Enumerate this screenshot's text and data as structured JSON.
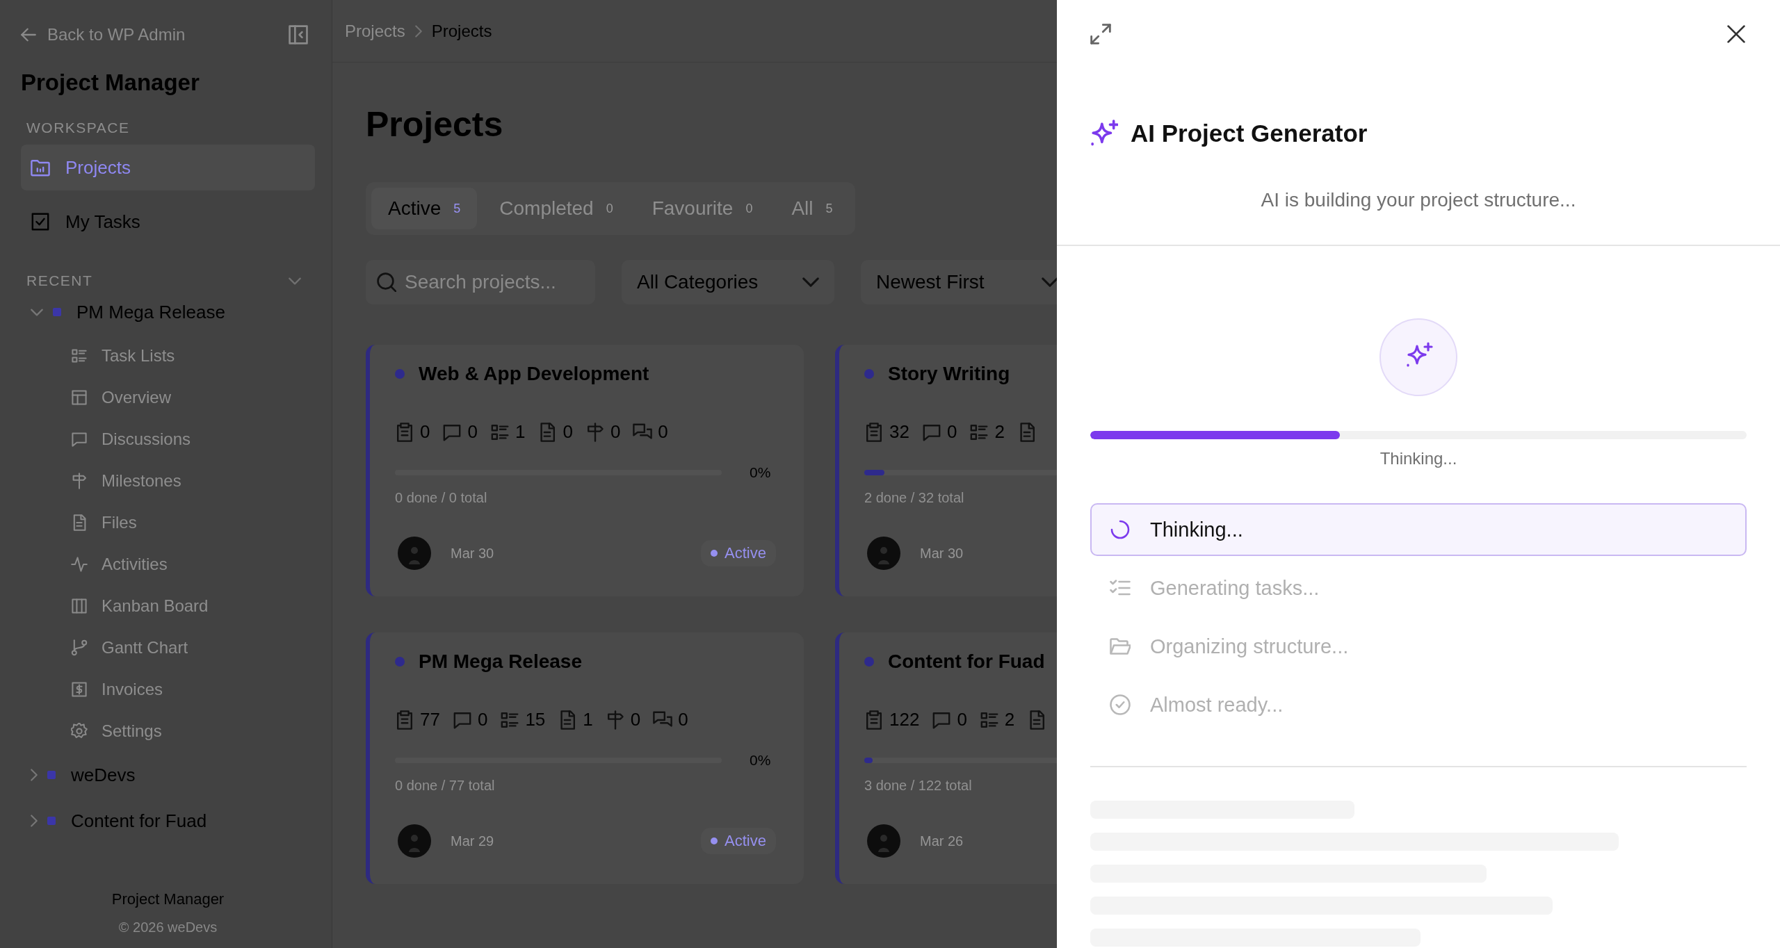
{
  "sidebar": {
    "back_link": "Back to WP Admin",
    "app_title": "Project Manager",
    "workspace_label": "WORKSPACE",
    "workspace_items": [
      {
        "label": "Projects",
        "kind": "folder",
        "selected": true
      },
      {
        "label": "My Tasks",
        "kind": "checkbox",
        "selected": false
      }
    ],
    "recent_label": "RECENT",
    "recent_projects": [
      {
        "name": "PM Mega Release",
        "expanded": true,
        "children": [
          {
            "label": "Task Lists",
            "kind": "list"
          },
          {
            "label": "Overview",
            "kind": "overview"
          },
          {
            "label": "Discussions",
            "kind": "comment"
          },
          {
            "label": "Milestones",
            "kind": "signpost"
          },
          {
            "label": "Files",
            "kind": "file"
          },
          {
            "label": "Activities",
            "kind": "activity"
          },
          {
            "label": "Kanban Board",
            "kind": "kanban"
          },
          {
            "label": "Gantt Chart",
            "kind": "branch"
          },
          {
            "label": "Invoices",
            "kind": "invoice"
          },
          {
            "label": "Settings",
            "kind": "settings"
          }
        ]
      },
      {
        "name": "weDevs",
        "expanded": false
      },
      {
        "name": "Content for Fuad",
        "expanded": false
      }
    ],
    "footer": {
      "title": "Project Manager",
      "copyright": "© 2026 weDevs"
    }
  },
  "breadcrumb": [
    "Projects",
    "Projects"
  ],
  "page_title": "Projects",
  "tabs": [
    {
      "label": "Active",
      "count": "5",
      "selected": true
    },
    {
      "label": "Completed",
      "count": "0",
      "selected": false
    },
    {
      "label": "Favourite",
      "count": "0",
      "selected": false
    },
    {
      "label": "All",
      "count": "5",
      "selected": false
    }
  ],
  "search": {
    "placeholder": "Search projects..."
  },
  "filters": [
    "All Categories",
    "Newest First"
  ],
  "projects": [
    {
      "name": "Web & App Development",
      "stats": [
        {
          "kind": "tasks",
          "value": "0"
        },
        {
          "kind": "comments",
          "value": "0"
        },
        {
          "kind": "lists",
          "value": "1"
        },
        {
          "kind": "files",
          "value": "0"
        },
        {
          "kind": "milestones",
          "value": "0"
        },
        {
          "kind": "discussions",
          "value": "0"
        }
      ],
      "level": 0,
      "percent": "0%",
      "progress_text": "0 done / 0 total",
      "date": "Mar 30",
      "status": "Active"
    },
    {
      "name": "Story Writing",
      "stats": [
        {
          "kind": "tasks",
          "value": "32"
        },
        {
          "kind": "comments",
          "value": "0"
        },
        {
          "kind": "lists",
          "value": "2"
        },
        {
          "kind": "files"
        }
      ],
      "level": 0.0625,
      "progress_text": "2 done / 32 total",
      "date": "Mar 30"
    },
    {
      "name": "PM Mega Release",
      "stats": [
        {
          "kind": "tasks",
          "value": "77"
        },
        {
          "kind": "comments",
          "value": "0"
        },
        {
          "kind": "lists",
          "value": "15"
        },
        {
          "kind": "files",
          "value": "1"
        },
        {
          "kind": "milestones",
          "value": "0"
        },
        {
          "kind": "discussions",
          "value": "0"
        }
      ],
      "level": 0,
      "percent": "0%",
      "progress_text": "0 done / 77 total",
      "date": "Mar 29",
      "status": "Active"
    },
    {
      "name": "Content for Fuad",
      "stats": [
        {
          "kind": "tasks",
          "value": "122"
        },
        {
          "kind": "comments",
          "value": "0"
        },
        {
          "kind": "lists",
          "value": "2"
        },
        {
          "kind": "files"
        }
      ],
      "level": 0.025,
      "progress_text": "3 done / 122 total",
      "date": "Mar 26"
    }
  ],
  "panel": {
    "title": "AI Project Generator",
    "subtitle": "AI is building your project structure...",
    "level": 0.38,
    "progress_label": "Thinking...",
    "steps": [
      {
        "label": "Thinking...",
        "kind": "spinner",
        "active": true
      },
      {
        "label": "Generating tasks...",
        "kind": "checklist",
        "active": false
      },
      {
        "label": "Organizing structure...",
        "kind": "folder-open",
        "active": false
      },
      {
        "label": "Almost ready...",
        "kind": "check-circle",
        "active": false
      }
    ]
  }
}
